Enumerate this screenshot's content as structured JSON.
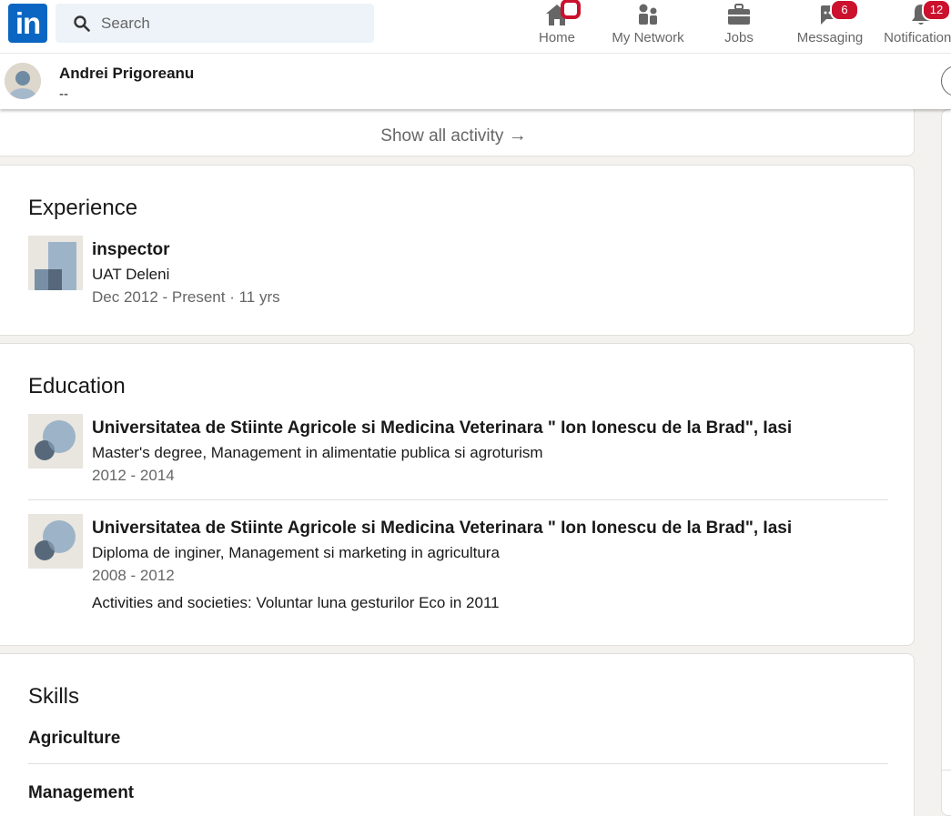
{
  "nav": {
    "logo_text": "in",
    "search_placeholder": "Search",
    "items": [
      {
        "label": "Home",
        "icon": "home-icon",
        "badge": ""
      },
      {
        "label": "My Network",
        "icon": "my-network-icon",
        "badge": ""
      },
      {
        "label": "Jobs",
        "icon": "jobs-icon",
        "badge": ""
      },
      {
        "label": "Messaging",
        "icon": "messaging-icon",
        "badge": "6"
      },
      {
        "label": "Notifications",
        "icon": "bell-icon",
        "badge": "12"
      }
    ]
  },
  "profile_header": {
    "name": "Andrei Prigoreanu",
    "headline": "--"
  },
  "activity": {
    "show_all_label": "Show all activity",
    "arrow": "→"
  },
  "experience": {
    "title": "Experience",
    "items": [
      {
        "role": "inspector",
        "company": "UAT Deleni",
        "dates": "Dec 2012 - Present · 11 yrs"
      }
    ]
  },
  "education": {
    "title": "Education",
    "items": [
      {
        "school": "Universitatea de Stiinte Agricole si Medicina Veterinara \" Ion Ionescu de la Brad\", Iasi",
        "degree": "Master's degree, Management in alimentatie publica si agroturism",
        "dates": "2012 - 2014",
        "activities": ""
      },
      {
        "school": "Universitatea de Stiinte Agricole si Medicina Veterinara \" Ion Ionescu de la Brad\", Iasi",
        "degree": "Diploma de inginer, Management si marketing in agricultura",
        "dates": "2008 - 2012",
        "activities": "Activities and societies: Voluntar luna gesturilor Eco in 2011"
      }
    ]
  },
  "skills": {
    "title": "Skills",
    "items": [
      "Agriculture",
      "Management"
    ]
  },
  "colors": {
    "brand": "#0a66c2",
    "badge": "#cb112d",
    "background": "#f4f2ee"
  }
}
